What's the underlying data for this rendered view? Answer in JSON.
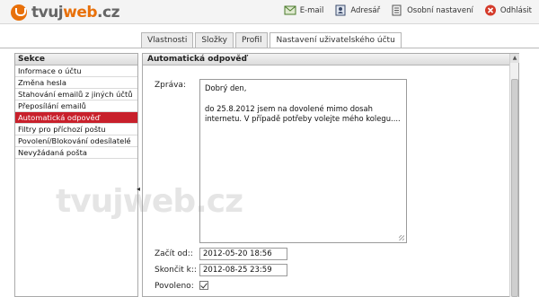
{
  "brand": {
    "logo_text_pre": "tvuj",
    "logo_text_w": "web",
    "logo_text_post": ".cz",
    "accent": "#e8700a"
  },
  "toplinks": [
    {
      "label": "E-mail",
      "icon": "email-icon"
    },
    {
      "label": "Adresář",
      "icon": "address-book-icon"
    },
    {
      "label": "Osobní nastavení",
      "icon": "settings-icon"
    },
    {
      "label": "Odhlásit",
      "icon": "logout-icon"
    }
  ],
  "tabs": [
    {
      "label": "Vlastnosti"
    },
    {
      "label": "Složky"
    },
    {
      "label": "Profil"
    },
    {
      "label": "Nastavení uživatelského účtu",
      "active": true
    }
  ],
  "sidebar": {
    "title": "Sekce",
    "items": [
      {
        "label": "Informace o účtu"
      },
      {
        "label": "Změna hesla"
      },
      {
        "label": "Stahování emailů z jiných účtů"
      },
      {
        "label": "Přeposílání emailů"
      },
      {
        "label": "Automatická odpověď",
        "active": true
      },
      {
        "label": "Filtry pro příchozí poštu"
      },
      {
        "label": "Povolení/Blokování odesílatelé"
      },
      {
        "label": "Nevyžádaná pošta"
      }
    ]
  },
  "main": {
    "title": "Automatická odpověď",
    "message_label": "Zpráva:",
    "message_lines": [
      "Dobrý den,",
      "do 25.8.2012 jsem na dovolené mimo dosah internetu. V případě potřeby volejte mého kolegu...."
    ],
    "start_label": "Začít od::",
    "start_value": "2012-05-20 18:56",
    "end_label": "Skončit k::",
    "end_value": "2012-08-25 23:59",
    "enabled_label": "Povoleno:",
    "enabled": true
  },
  "watermark": "tvujweb.cz",
  "colors": {
    "active_item": "#c8202b",
    "panel_border": "#aaaaaa"
  }
}
